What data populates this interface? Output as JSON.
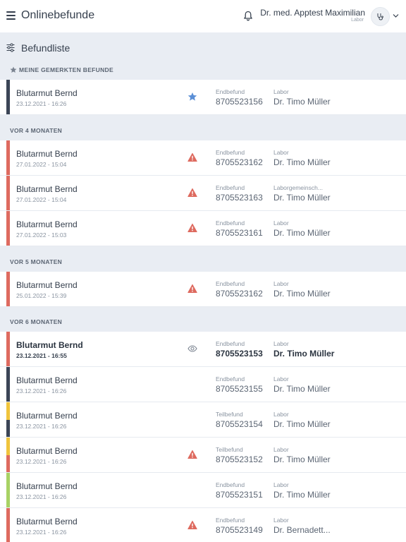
{
  "header": {
    "app_title": "Onlinebefunde",
    "user_name": "Dr. med. Apptest Maximilian",
    "user_role": "Labor",
    "menu_icon": "hamburger-menu-icon",
    "bell_icon": "bell-icon",
    "avatar_icon": "stethoscope-icon",
    "chevron_icon": "chevron-down-icon"
  },
  "list": {
    "title": "Befundliste",
    "filter_icon": "filter-sliders-icon"
  },
  "colors": {
    "red": "#de6a5f",
    "navy": "#3b4556",
    "yellow": "#f0c43c",
    "green": "#a8d264",
    "star": "#5b8fd6",
    "warning": "#de6a5f"
  },
  "sections": [
    {
      "heading": "Meine gemerkten Befunde",
      "heading_icon": "star-icon",
      "rows": [
        {
          "patient": "Blutarmut Bernd",
          "datetime": "23.12.2021 - 16:26",
          "status": "star",
          "type_label": "Endbefund",
          "report_no": "8705523156",
          "lab_label": "Labor",
          "doctor": "Dr. Timo Müller",
          "bar": [
            "navy",
            "navy"
          ],
          "unread": false
        }
      ]
    },
    {
      "heading": "Vor 4 Monaten",
      "rows": [
        {
          "patient": "Blutarmut Bernd",
          "datetime": "27.01.2022 - 15:04",
          "status": "warning",
          "type_label": "Endbefund",
          "report_no": "8705523162",
          "lab_label": "Labor",
          "doctor": "Dr. Timo Müller",
          "bar": [
            "red",
            "red"
          ],
          "unread": false
        },
        {
          "patient": "Blutarmut Bernd",
          "datetime": "27.01.2022 - 15:04",
          "status": "warning",
          "type_label": "Endbefund",
          "report_no": "8705523163",
          "lab_label": "Laborgemeinsch...",
          "doctor": "Dr. Timo Müller",
          "bar": [
            "red",
            "red"
          ],
          "unread": false
        },
        {
          "patient": "Blutarmut Bernd",
          "datetime": "27.01.2022 - 15:03",
          "status": "warning",
          "type_label": "Endbefund",
          "report_no": "8705523161",
          "lab_label": "Labor",
          "doctor": "Dr. Timo Müller",
          "bar": [
            "red",
            "red"
          ],
          "unread": false
        }
      ]
    },
    {
      "heading": "Vor 5 Monaten",
      "rows": [
        {
          "patient": "Blutarmut Bernd",
          "datetime": "25.01.2022 - 15:39",
          "status": "warning",
          "type_label": "Endbefund",
          "report_no": "8705523162",
          "lab_label": "Labor",
          "doctor": "Dr. Timo Müller",
          "bar": [
            "red",
            "red"
          ],
          "unread": false
        }
      ]
    },
    {
      "heading": "Vor 6 Monaten",
      "rows": [
        {
          "patient": "Blutarmut Bernd",
          "datetime": "23.12.2021 - 16:55",
          "status": "eye",
          "type_label": "Endbefund",
          "report_no": "8705523153",
          "lab_label": "Labor",
          "doctor": "Dr. Timo Müller",
          "bar": [
            "red",
            "red"
          ],
          "unread": true
        },
        {
          "patient": "Blutarmut Bernd",
          "datetime": "23.12.2021 - 16:26",
          "status": "",
          "type_label": "Endbefund",
          "report_no": "8705523155",
          "lab_label": "Labor",
          "doctor": "Dr. Timo Müller",
          "bar": [
            "navy",
            "navy"
          ],
          "unread": false
        },
        {
          "patient": "Blutarmut Bernd",
          "datetime": "23.12.2021 - 16:26",
          "status": "",
          "type_label": "Teilbefund",
          "report_no": "8705523154",
          "lab_label": "Labor",
          "doctor": "Dr. Timo Müller",
          "bar": [
            "yellow",
            "navy"
          ],
          "unread": false
        },
        {
          "patient": "Blutarmut Bernd",
          "datetime": "23.12.2021 - 16:26",
          "status": "warning",
          "type_label": "Teilbefund",
          "report_no": "8705523152",
          "lab_label": "Labor",
          "doctor": "Dr. Timo Müller",
          "bar": [
            "yellow",
            "red"
          ],
          "unread": false
        },
        {
          "patient": "Blutarmut Bernd",
          "datetime": "23.12.2021 - 16:26",
          "status": "",
          "type_label": "Endbefund",
          "report_no": "8705523151",
          "lab_label": "Labor",
          "doctor": "Dr. Timo Müller",
          "bar": [
            "green",
            "green"
          ],
          "unread": false
        },
        {
          "patient": "Blutarmut Bernd",
          "datetime": "23.12.2021 - 16:26",
          "status": "warning",
          "type_label": "Endbefund",
          "report_no": "8705523149",
          "lab_label": "Labor",
          "doctor": "Dr. Bernadett...",
          "bar": [
            "red",
            "red"
          ],
          "unread": false
        }
      ]
    }
  ]
}
